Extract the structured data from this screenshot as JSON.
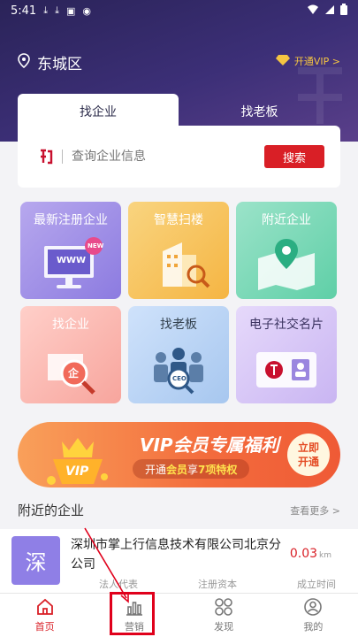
{
  "status_bar": {
    "time": "5:41"
  },
  "header": {
    "location": "东城区",
    "vip_link": "开通VIP >"
  },
  "search": {
    "tabs": [
      "找企业",
      "找老板"
    ],
    "placeholder": "查询企业信息",
    "button": "搜索"
  },
  "tiles": [
    {
      "label": "最新注册企业",
      "badge": "NEW",
      "art_text": "WWW"
    },
    {
      "label": "智慧扫楼"
    },
    {
      "label": "附近企业"
    },
    {
      "label": "找企业",
      "art_text": "企"
    },
    {
      "label": "找老板",
      "art_text": "CEO"
    },
    {
      "label": "电子社交名片"
    }
  ],
  "banner": {
    "title": "VIP会员专属福利",
    "sub_prefix": "开通",
    "sub_highlight1": "会员",
    "sub_mid": "享",
    "sub_highlight2": "7项特权",
    "cta_line1": "立即",
    "cta_line2": "开通",
    "vip_badge": "VIP"
  },
  "nearby": {
    "title": "附近的企业",
    "more": "查看更多 >",
    "company": {
      "avatar_char": "深",
      "name": "深圳市掌上行信息技术有限公司北京分公司",
      "distance": "0.03",
      "distance_unit": "km",
      "meta": [
        "法人代表",
        "注册资本",
        "成立时间"
      ]
    }
  },
  "tabbar": {
    "items": [
      {
        "label": "首页",
        "icon": "home-icon"
      },
      {
        "label": "营销",
        "icon": "bar-chart-icon"
      },
      {
        "label": "发现",
        "icon": "discover-icon"
      },
      {
        "label": "我的",
        "icon": "profile-icon"
      }
    ]
  },
  "colors": {
    "brand_red": "#d91f26",
    "hero_purple": "#2a2358",
    "accent_gold": "#f5c542"
  }
}
